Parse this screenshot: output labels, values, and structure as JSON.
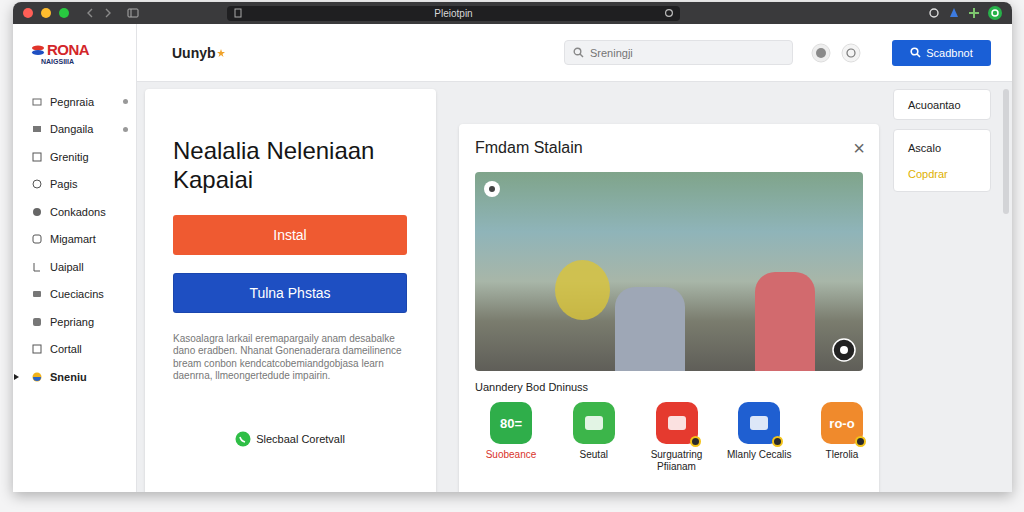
{
  "window": {
    "title": "Pleiotpin"
  },
  "header": {
    "logo": {
      "name": "RONA",
      "tagline": "NAIGSIIIA"
    },
    "brand": "Uunyb",
    "search": {
      "placeholder": "Sreningji"
    },
    "button": "Scadbnot"
  },
  "sidebar": {
    "items": [
      {
        "label": "Pegnraia",
        "badge": true,
        "selected": false
      },
      {
        "label": "Dangaila",
        "badge": true,
        "selected": false
      },
      {
        "label": "Grenitig",
        "badge": false,
        "selected": false
      },
      {
        "label": "Pagis",
        "badge": false,
        "selected": false
      },
      {
        "label": "Conkadons",
        "badge": false,
        "selected": false
      },
      {
        "label": "Migamart",
        "badge": false,
        "selected": false
      },
      {
        "label": "Uaipall",
        "badge": false,
        "selected": false
      },
      {
        "label": "Cueciacins",
        "badge": false,
        "selected": false
      },
      {
        "label": "Pepriang",
        "badge": false,
        "selected": false
      },
      {
        "label": "Cortall",
        "badge": false,
        "selected": false
      },
      {
        "label": "Sneniu",
        "badge": false,
        "selected": true
      }
    ]
  },
  "hero": {
    "title": "Nealalia Neleniaan Kapaiai",
    "buttons": [
      {
        "label": "Instal",
        "kind": "primary",
        "color": "#ef5a31"
      },
      {
        "label": "Tulna Phstas",
        "kind": "secondary",
        "color": "#1e4fc2"
      }
    ],
    "description": "Kasoalagra larkail eremapargaily anam desabalke dano eradben. Nhanat Gonenaderara dameilinence bream conbon kendcatcobemiandgobjasa learn daenrna, llmeongertedude impairin.",
    "contact": "Slecbaal Coretvall"
  },
  "panel": {
    "title": "Fmdam Stalain",
    "close": "×",
    "section": "Uanndery Bod Dninuss",
    "apps": [
      {
        "label": "Suobeance",
        "glyph": "80=",
        "color": "#2fae4a",
        "badge": false,
        "selected": true
      },
      {
        "label": "Seutal",
        "color": "#3cb54a",
        "badge": false,
        "selected": false
      },
      {
        "label": "Surguatring Pfiianam",
        "color": "#e53a2f",
        "badge": true,
        "selected": false
      },
      {
        "label": "Mlanly Cecalis",
        "color": "#1f5fd1",
        "badge": true,
        "selected": false
      },
      {
        "label": "Tlerolia",
        "glyph": "ro-o",
        "color": "#f08a2c",
        "badge": true,
        "selected": false
      }
    ]
  },
  "right": {
    "cards": [
      {
        "lines": [
          {
            "text": "Acuoantao",
            "highlight": false
          }
        ]
      },
      {
        "lines": [
          {
            "text": "Ascalo",
            "highlight": false
          },
          {
            "text": "Copdrar",
            "highlight": true
          }
        ]
      }
    ]
  }
}
